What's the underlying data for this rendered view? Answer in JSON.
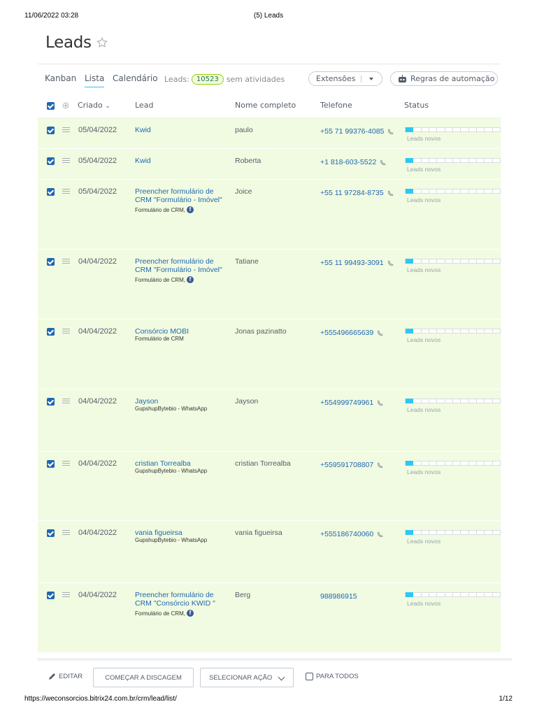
{
  "print": {
    "datetime": "11/06/2022 03:28",
    "doc_title": "(5) Leads",
    "url": "https://weconsorcios.bitrix24.com.br/crm/lead/list/",
    "page": "1/12"
  },
  "page": {
    "title": "Leads"
  },
  "toolbar": {
    "tabs": [
      {
        "label": "Kanban",
        "active": false
      },
      {
        "label": "Lista",
        "active": true
      },
      {
        "label": "Calendário",
        "active": false
      }
    ],
    "leads_label": "Leads:",
    "leads_count": "10523",
    "leads_suffix": "sem atividades",
    "extensions_label": "Extensões",
    "rules_label": "Regras de automação"
  },
  "grid": {
    "columns": {
      "created": "Criado",
      "lead": "Lead",
      "full_name": "Nome completo",
      "phone": "Telefone",
      "status": "Status"
    },
    "rows": [
      {
        "date": "05/04/2022",
        "lead": "Kwid",
        "source": "",
        "name": "paulo",
        "phone": "+55 71 99376-4085",
        "status": "Leads novos"
      },
      {
        "date": "05/04/2022",
        "lead": "Kwid",
        "source": "",
        "name": "Roberta",
        "phone": "+1 818-603-5522",
        "status": "Leads novos"
      },
      {
        "date": "05/04/2022",
        "lead": "Preencher formulário de CRM \"Formulário - Imóvel\"",
        "source": "Formulário de CRM,",
        "name": "Joice",
        "phone": "+55 11 97284-8735",
        "status": "Leads novos"
      },
      {
        "date": "04/04/2022",
        "lead": "Preencher formulário de CRM \"Formulário - Imóvel\"",
        "source": "Formulário de CRM,",
        "name": "Tatiane",
        "phone": "+55 11 99493-3091",
        "status": "Leads novos"
      },
      {
        "date": "04/04/2022",
        "lead": "Consórcio MOBI",
        "source": "Formulário de CRM",
        "name": "Jonas pazinatto",
        "phone": "+555496665639",
        "status": "Leads novos"
      },
      {
        "date": "04/04/2022",
        "lead": "Jayson",
        "source": "GupshupBytebio - WhatsApp",
        "name": "Jayson",
        "phone": "+554999749961",
        "status": "Leads novos"
      },
      {
        "date": "04/04/2022",
        "lead": "cristian Torrealba",
        "source": "GupshupBytebio - WhatsApp",
        "name": "cristian Torrealba",
        "phone": "+559591708807",
        "status": "Leads novos"
      },
      {
        "date": "04/04/2022",
        "lead": "vania figueirsa",
        "source": "GupshupBytebio - WhatsApp",
        "name": "vania figueirsa",
        "phone": "+555186740060",
        "status": "Leads novos"
      },
      {
        "date": "04/04/2022",
        "lead": "Preencher formulário de CRM \"Consórcio KWID \"",
        "source": "Formulário de CRM,",
        "name": "Berg",
        "phone": "988986915",
        "status": "Leads novos"
      }
    ]
  },
  "actions": {
    "edit": "EDITAR",
    "dial": "COMEÇAR A DISCAGEM",
    "select_action": "SELECIONAR AÇÃO",
    "for_all": "PARA TODOS"
  },
  "icons": {
    "facebook": "f"
  },
  "colors": {
    "link": "#2067b0",
    "row_bg": "#f1fbe1",
    "status_fill": "#2fc6f6"
  }
}
